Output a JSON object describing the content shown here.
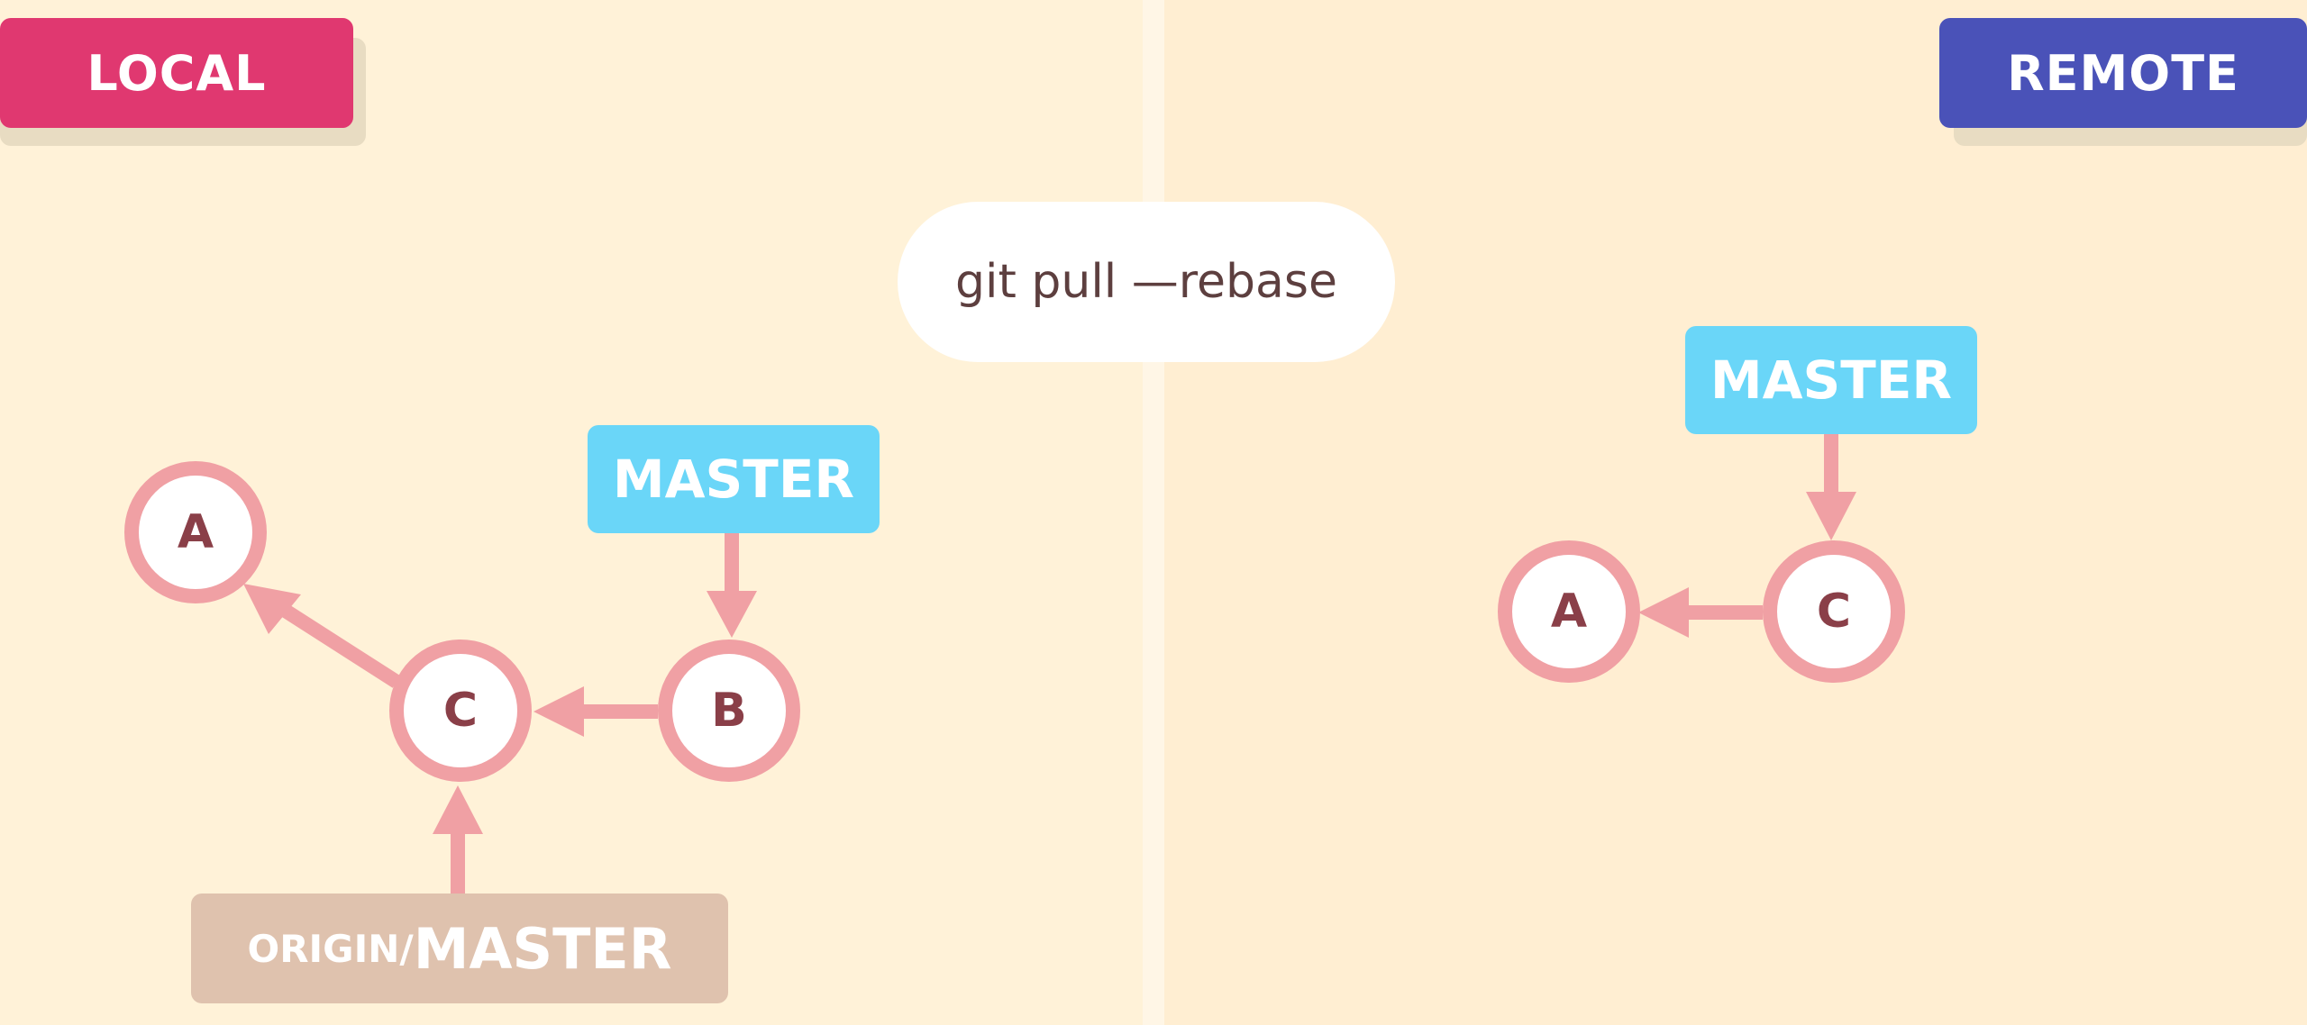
{
  "local": {
    "title": "LOCAL",
    "commits": {
      "a": "A",
      "c": "C",
      "b": "B"
    },
    "branch_label": "MASTER",
    "tracking_label": {
      "prefix": "ORIGIN/",
      "name": "MASTER"
    }
  },
  "remote": {
    "title": "REMOTE",
    "commits": {
      "a": "A",
      "c": "C"
    },
    "branch_label": "MASTER"
  },
  "command": "git pull —rebase",
  "colors": {
    "local_tag": "#e03870",
    "remote_tag": "#4a52b8",
    "branch": "#6ad6f8",
    "tracking": "#dfc2ae",
    "commit_ring": "#f0a0a4",
    "arrow": "#f0a0a4",
    "commit_text": "#8a3f48"
  }
}
